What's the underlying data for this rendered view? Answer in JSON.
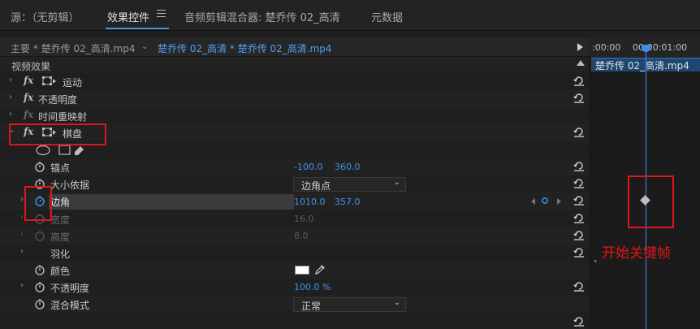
{
  "tabs": [
    {
      "label": "源：（无剪辑）"
    },
    {
      "label": "效果控件"
    },
    {
      "label": "音频剪辑混合器: 楚乔传 02_高清"
    },
    {
      "label": "元数据"
    }
  ],
  "source": {
    "main_clip": "主要 * 楚乔传 02_高清.mp4",
    "sequence_clip": "楚乔传 02_高清 * 楚乔传 02_高清.mp4"
  },
  "section_title": "视频效果",
  "effects": {
    "motion": "运动",
    "opacity": "不透明度",
    "time_remap": "时间重映射",
    "checkerboard": "棋盘"
  },
  "params": {
    "anchor": {
      "label": "锚点",
      "x": "-100.0",
      "y": "360.0"
    },
    "size_from": {
      "label": "大小依据",
      "value": "边角点"
    },
    "corner": {
      "label": "边角",
      "x": "1010.0",
      "y": "357.0"
    },
    "width": {
      "label": "宽度",
      "value": "16.0"
    },
    "height": {
      "label": "高度",
      "value": "8.0"
    },
    "feather": {
      "label": "羽化"
    },
    "color": {
      "label": "颜色",
      "value": "#ffffff"
    },
    "opacity": {
      "label": "不透明度",
      "value": "100.0 %"
    },
    "blend_mode": {
      "label": "混合模式",
      "value": "正常"
    }
  },
  "timeline": {
    "tick_left": ":00:00",
    "tick_right": "00:00:01:00",
    "clip_label": "楚乔传 02_高清.mp4"
  },
  "annotation": "开始关键帧",
  "colors": {
    "accent": "#3c8ff0",
    "highlight_red": "#e0161b",
    "clip": "#1d4670"
  }
}
